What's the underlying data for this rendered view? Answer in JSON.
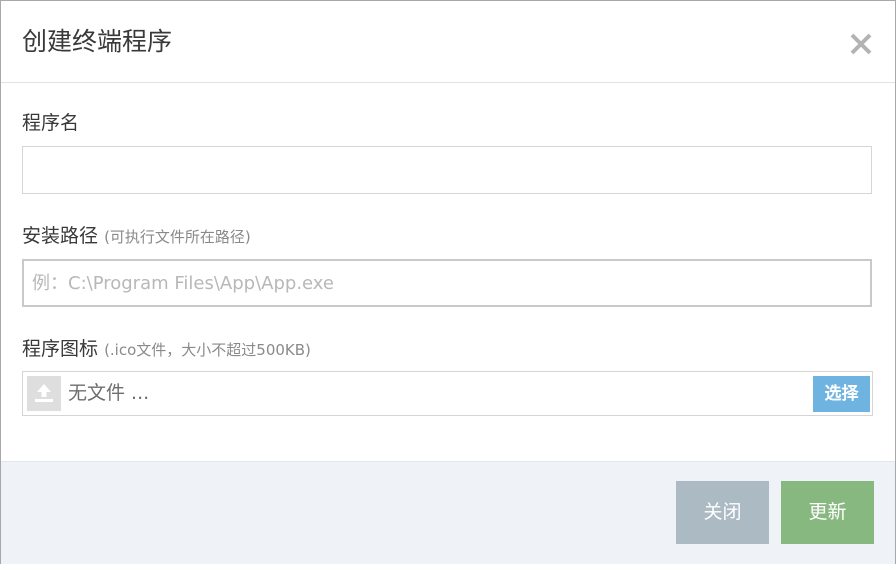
{
  "dialog": {
    "title": "创建终端程序"
  },
  "fields": {
    "name": {
      "label": "程序名",
      "value": ""
    },
    "path": {
      "label": "安装路径",
      "hint": "(可执行文件所在路径)",
      "placeholder": "例：C:\\Program Files\\App\\App.exe"
    },
    "icon": {
      "label": "程序图标",
      "hint": "(.ico文件，大小不超过500KB)",
      "file_text": "无文件 ...",
      "select_label": "选择"
    }
  },
  "footer": {
    "close_label": "关闭",
    "update_label": "更新"
  },
  "colors": {
    "select_button": "#6fb3e0",
    "close_button": "#abbac3",
    "update_button": "#87b87f",
    "footer_bg": "#eff3f8"
  }
}
